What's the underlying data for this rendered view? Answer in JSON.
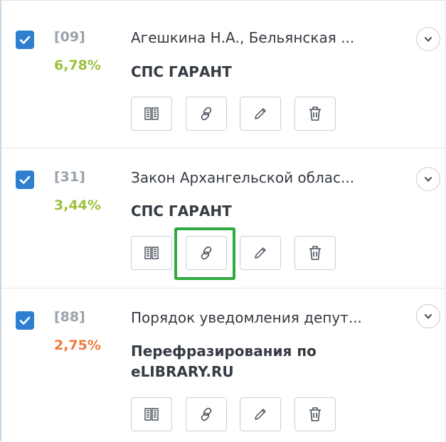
{
  "colors": {
    "checkbox": "#2f7fd0",
    "pct_high": "#9bc13b",
    "pct_low": "#ee7a3e",
    "highlight": "#2eaa3f"
  },
  "items": [
    {
      "index": "[09]",
      "percent": "6,78%",
      "percent_color": "#9bc13b",
      "title": "Агешкина Н.А., Бельянская ...",
      "source": "СПС ГАРАНТ",
      "checked": true
    },
    {
      "index": "[31]",
      "percent": "3,44%",
      "percent_color": "#9bc13b",
      "title": "Закон Архангельской облас...",
      "source": "СПС ГАРАНТ",
      "checked": true
    },
    {
      "index": "[88]",
      "percent": "2,75%",
      "percent_color": "#ee7a3e",
      "title": "Порядок уведомления депут...",
      "source": "Перефразирования по eLIBRARY.RU",
      "checked": true
    }
  ],
  "icons": {
    "checkbox": "checkmark-icon",
    "expand": "chevron-down-icon",
    "view": "book-icon",
    "link": "link-icon",
    "edit": "pencil-icon",
    "delete": "trash-icon"
  }
}
